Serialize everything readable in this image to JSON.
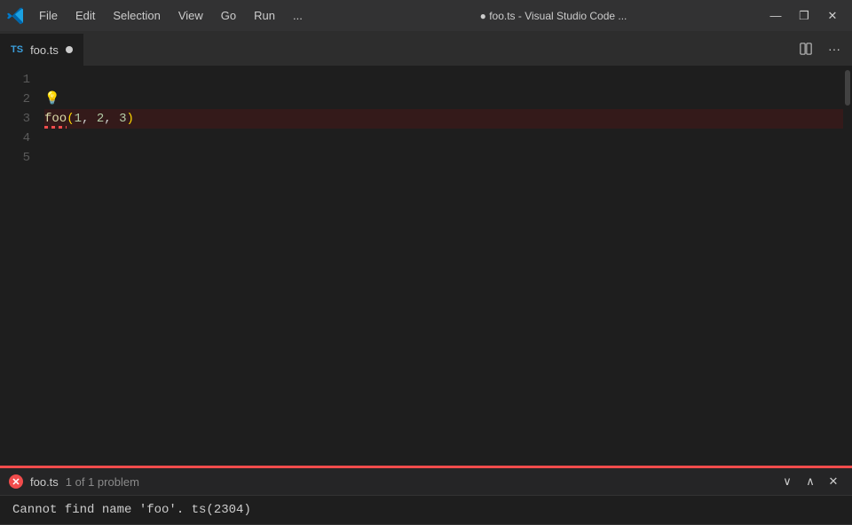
{
  "titleBar": {
    "title": "● foo.ts - Visual Studio Code ...",
    "menuItems": [
      "File",
      "Edit",
      "Selection",
      "View",
      "Go",
      "Run",
      "..."
    ],
    "windowControls": {
      "minimize": "—",
      "maximize": "❐",
      "close": "✕"
    }
  },
  "tabs": [
    {
      "lang": "TS",
      "name": "foo.ts",
      "modified": true
    }
  ],
  "editor": {
    "lines": [
      {
        "num": "1",
        "content": ""
      },
      {
        "num": "2",
        "content": ""
      },
      {
        "num": "3",
        "content": "foo(1, 2, 3)",
        "error": true
      },
      {
        "num": "4",
        "content": ""
      },
      {
        "num": "5",
        "content": ""
      }
    ]
  },
  "errorPanel": {
    "filename": "foo.ts",
    "problemCount": "1 of 1 problem",
    "message": "Cannot find name 'foo'. ts(2304)"
  },
  "icons": {
    "lightbulb": "💡",
    "error": "✕",
    "chevronDown": "∨",
    "chevronUp": "∧",
    "close": "✕",
    "splitEditor": "⊞",
    "more": "···"
  }
}
